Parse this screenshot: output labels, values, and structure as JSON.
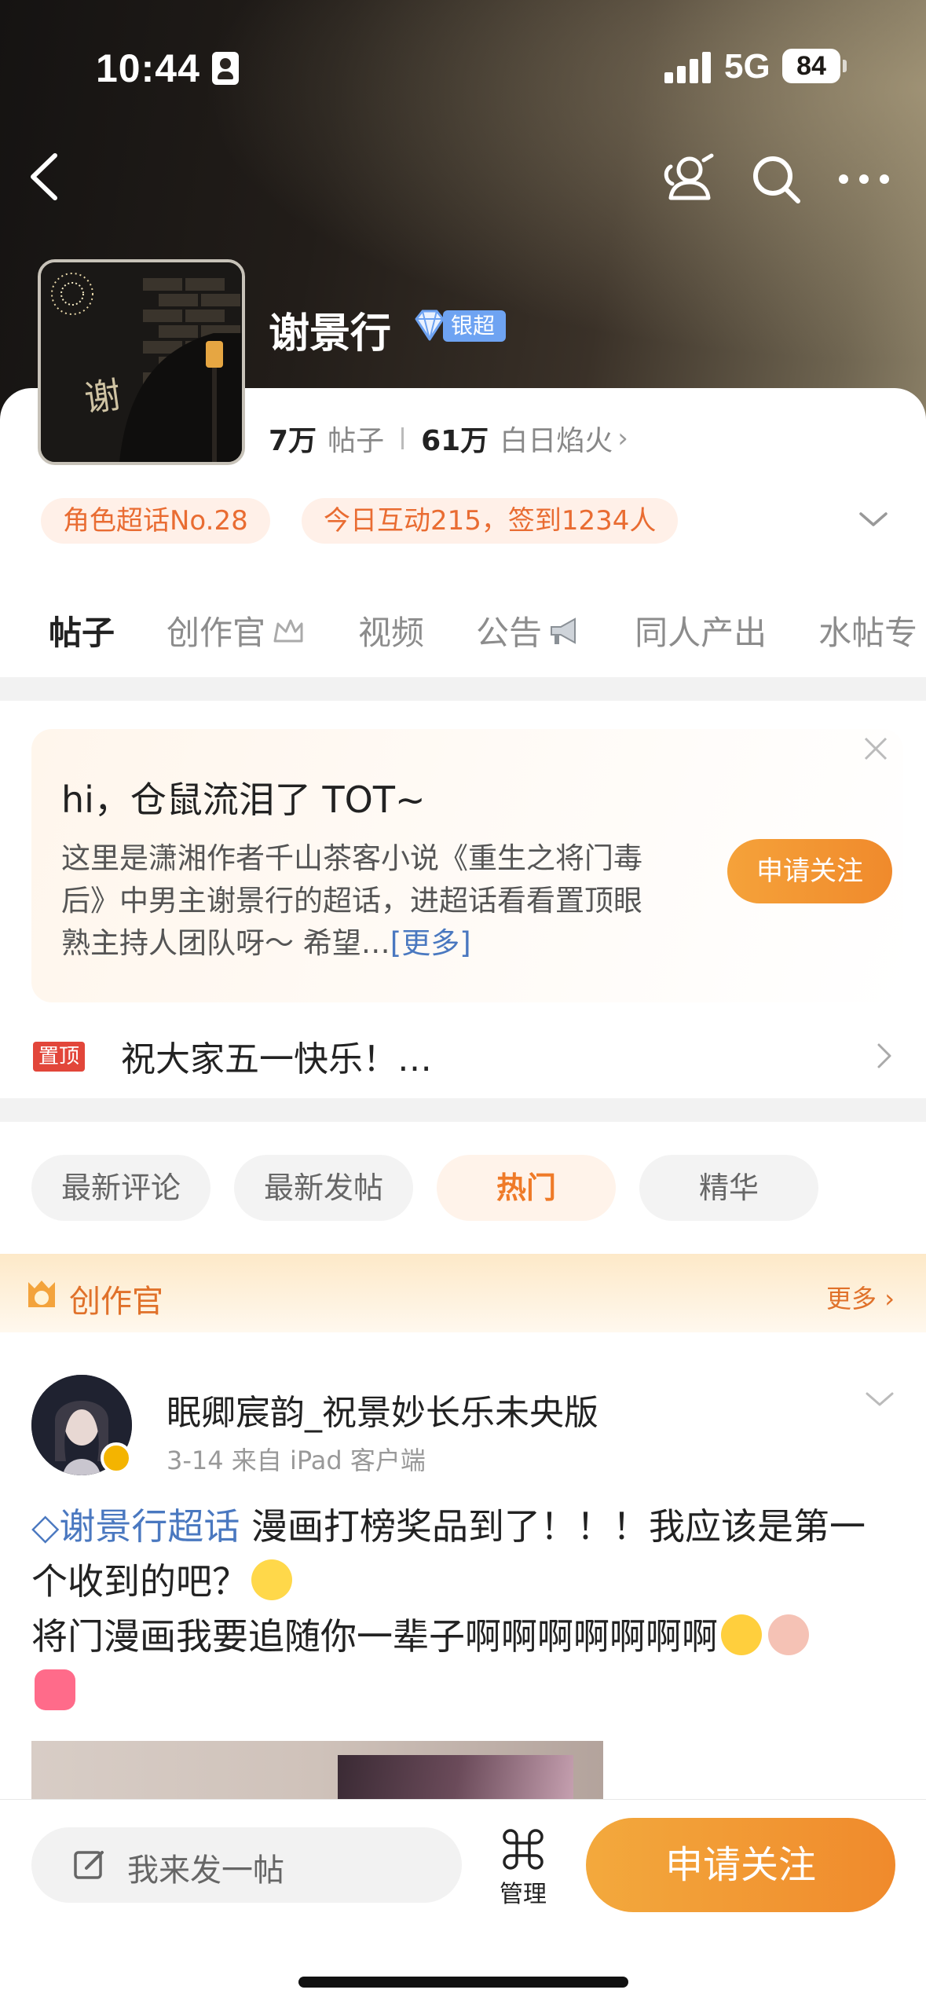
{
  "status_bar": {
    "time": "10:44",
    "network": "5G",
    "battery": "84"
  },
  "topic": {
    "name": "谢景行",
    "badge": "银超",
    "posts_count": "7万",
    "posts_label": "帖子",
    "fans_count": "61万",
    "fans_label": "白日焰火"
  },
  "chips": [
    "角色超话No.28",
    "今日互动215，签到1234人"
  ],
  "tabs": [
    "帖子",
    "创作官",
    "视频",
    "公告",
    "同人产出",
    "水帖专"
  ],
  "intro": {
    "title": "hi，仓鼠流泪了 TOT~",
    "text": "这里是潇湘作者千山茶客小说《重生之将门毒后》中男主谢景行的超话，进超话看看置顶眼熟主持人团队呀～ 希望…",
    "more": "[更多]",
    "follow_label": "申请关注"
  },
  "pinned": {
    "tag": "置顶",
    "text": "祝大家五一快乐！…"
  },
  "filters": [
    "最新评论",
    "最新发帖",
    "热门",
    "精华"
  ],
  "section": {
    "title": "创作官",
    "more": "更多"
  },
  "post": {
    "author": "眠卿宸韵_祝景妙长乐未央版",
    "meta": "3-14  来自 iPad 客户端",
    "topic": "谢景行超话",
    "line1": "漫画打榜奖品到了！！！我应该是第一个收到的吧？",
    "line2": "将门漫画我要追随你一辈子啊啊啊啊啊啊啊"
  },
  "bottom_bar": {
    "compose_placeholder": "我来发一帖",
    "manage_label": "管理",
    "follow_label": "申请关注"
  },
  "colors": {
    "accent": "#f08a2c",
    "link": "#4a78c0",
    "pin_red": "#e2463a",
    "badge_blue": "#6ea3f2"
  }
}
